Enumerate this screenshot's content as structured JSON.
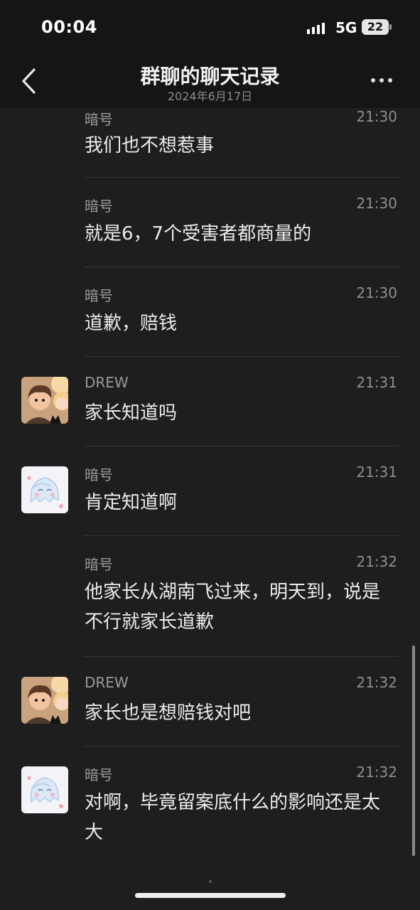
{
  "status": {
    "time": "00:04",
    "network": "5G",
    "battery": "22"
  },
  "header": {
    "title": "群聊的聊天记录",
    "date": "2024年6月17日"
  },
  "messages": [
    {
      "sender": "暗号",
      "time": "21:30",
      "text": "我们也不想惹事",
      "avatar": "none"
    },
    {
      "sender": "暗号",
      "time": "21:30",
      "text": "就是6，7个受害者都商量的",
      "avatar": "none"
    },
    {
      "sender": "暗号",
      "time": "21:30",
      "text": "道歉，赔钱",
      "avatar": "none"
    },
    {
      "sender": "DREW",
      "time": "21:31",
      "text": "家长知道吗",
      "avatar": "boy-girl-avatar-icon"
    },
    {
      "sender": "暗号",
      "time": "21:31",
      "text": "肯定知道啊",
      "avatar": "ghost-avatar-icon"
    },
    {
      "sender": "暗号",
      "time": "21:32",
      "text": "他家长从湖南飞过来，明天到，说是不行就家长道歉",
      "avatar": "none"
    },
    {
      "sender": "DREW",
      "time": "21:32",
      "text": "家长也是想赔钱对吧",
      "avatar": "boy-girl-avatar-icon"
    },
    {
      "sender": "暗号",
      "time": "21:32",
      "text": "对啊，毕竟留案底什么的影响还是太大",
      "avatar": "ghost-avatar-icon"
    }
  ]
}
